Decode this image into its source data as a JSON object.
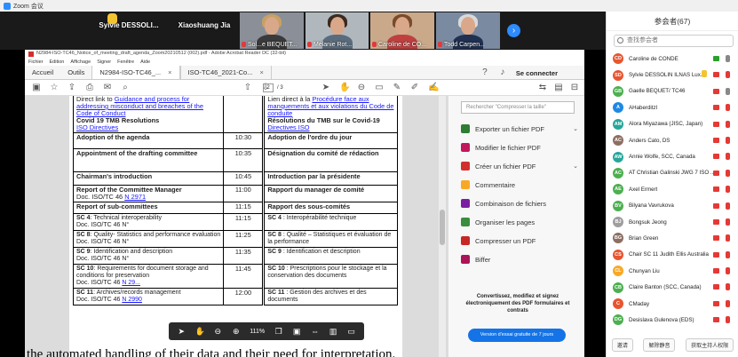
{
  "zoom": {
    "title": "Zoom 会议",
    "tiles": [
      {
        "name": "Sylvie  DESSOLI...",
        "video": false
      },
      {
        "name": "Xiaoshuang Jia",
        "video": false
      },
      {
        "name": "Sol...e BEQUET...",
        "video": true,
        "hair": "#c8a064",
        "shirt": "#3a3a3a",
        "bg": "#8a8f98"
      },
      {
        "name": "Mélanie Rot...",
        "video": true,
        "hair": "#3b2a1e",
        "shirt": "#5a6b7c",
        "bg": "#b0b8be"
      },
      {
        "name": "Caroline de CO...",
        "video": true,
        "hair": "#7a4a2a",
        "shirt": "#c04040",
        "bg": "#c9a98a"
      },
      {
        "name": "Todd Carpen...",
        "video": true,
        "hair": "#d9d9d9",
        "shirt": "#203050",
        "bg": "#7a8aa0"
      }
    ]
  },
  "acrobat": {
    "title": "N2984-ISO-TC46_Notice_of_meeting_draft_agenda_Zoom20210512 (002).pdf - Adobe Acrobat Reader DC (32-bit)",
    "menu": [
      "Fichier",
      "Edition",
      "Affichage",
      "Signer",
      "Fenêtre",
      "Aide"
    ],
    "tabs": {
      "home": "Accueil",
      "tools": "Outils",
      "doc1": "N2984-ISO-TC46_...",
      "doc2": "ISO-TC46_2021-Co..."
    },
    "connect": "Se connecter",
    "page_current": "2",
    "page_total": "/ 3",
    "zoom_level": "111%",
    "search_tools_placeholder": "Rechercher \"Compresser la taille\"",
    "tools": [
      {
        "label": "Exporter un fichier PDF",
        "color": "#2e7d32",
        "chev": true
      },
      {
        "label": "Modifier le fichier PDF",
        "color": "#c2185b",
        "chev": false
      },
      {
        "label": "Créer un fichier PDF",
        "color": "#d32f2f",
        "chev": true
      },
      {
        "label": "Commentaire",
        "color": "#f9a825",
        "chev": false
      },
      {
        "label": "Combinaison de fichiers",
        "color": "#7b1fa2",
        "chev": false
      },
      {
        "label": "Organiser les pages",
        "color": "#388e3c",
        "chev": false
      },
      {
        "label": "Compresser un PDF",
        "color": "#c62828",
        "chev": false
      },
      {
        "label": "Biffer",
        "color": "#ad1457",
        "chev": false
      }
    ],
    "promo_text": "Convertissez, modifiez et signez électroniquement des PDF formulaires et contrats",
    "promo_button": "Version d'essai gratuite de 7 jours"
  },
  "agenda": {
    "row0": {
      "en_pre": "Direct link to ",
      "en_link": "Guidance and process for addressing misconduct and breaches of the Code of Conduct",
      "en_bold": "Covid 19 TMB Resolutions",
      "en_link2": "ISO Directives",
      "fr_pre": "Lien direct à la ",
      "fr_link": "Procédure face aux manquements et aux violations du Code de conduite",
      "fr_bold": "Résolutions du TMB sur le Covid-19",
      "fr_link2": "Directives ISO"
    },
    "rows": [
      {
        "en": "Adoption of the agenda",
        "time": "10:30",
        "fr": "Adoption de l'ordre du jour"
      },
      {
        "en": "Appointment of the drafting committee",
        "time": "10:35",
        "fr": "Désignation du comité de rédaction"
      },
      {
        "en": "Chairman's introduction",
        "time": "10:45",
        "fr": "Introduction par la présidente"
      },
      {
        "en": "Report of the Committee Manager",
        "en_doc": "Doc. ISO/TC 46 ",
        "en_doc_link": "N 2971",
        "time": "11:00",
        "fr": "Rapport du manager de comité"
      },
      {
        "en": "Report of sub-committees",
        "time": "11:15",
        "fr": "Rapport des sous-comités"
      }
    ],
    "sc_rows": [
      {
        "en_b": "SC 4",
        "en": ": Technical interoperability",
        "en_doc": "Doc. ISO/TC 46 N°",
        "time": "11:15",
        "fr_b": "SC 4",
        "fr": " : Interopérabilité technique"
      },
      {
        "en_b": "SC 8",
        "en": ": Quality- Statistics and performance evaluation",
        "en_doc": "Doc. ISO/TC 46 N°",
        "time": "11:25",
        "fr_b": "SC 8",
        "fr": " : Qualité – Statistiques et évaluation de la performance"
      },
      {
        "en_b": "SC 9",
        "en": ": Identification and description",
        "en_doc": "Doc. ISO/TC 46 N°",
        "time": "11:35",
        "fr_b": "SC 9",
        "fr": " : Identification et description"
      },
      {
        "en_b": "SC 10",
        "en": ": Requirements for document storage and conditions for preservation",
        "en_doc": "Doc. ISO/TC 46 ",
        "en_doc_link": "N 29...",
        "time": "11:45",
        "fr_b": "SC 10",
        "fr": " : Prescriptions pour le stockage et la conservation des documents"
      },
      {
        "en_b": "SC 11",
        "en": ": Archives/records management",
        "en_doc": "Doc. ISO/TC 46 ",
        "en_doc_link": "N 2990",
        "time": "12:00",
        "fr_b": "SC 11",
        "fr": " : Gestion des archives et des documents"
      }
    ]
  },
  "caption": "the automated handling of their data and their need for interpretation.",
  "participants": {
    "header": "参会者(67)",
    "search_placeholder": "查找参会者",
    "list": [
      {
        "initials": "CD",
        "color": "#e8552f",
        "name": "Caroline de CONDE",
        "cam": "on",
        "mic": "on",
        "hand": false
      },
      {
        "initials": "SD",
        "color": "#e8552f",
        "name": "Sylvie DESSOLIN ILNAS Lux...",
        "cam": "off",
        "mic": "muted",
        "hand": true
      },
      {
        "initials": "GB",
        "color": "#4caf50",
        "name": "Gaelle BEQUET/ TC46",
        "cam": "off",
        "mic": "on",
        "hand": false
      },
      {
        "initials": "A",
        "color": "#1e88e5",
        "name": "AHaberditzl",
        "cam": "off",
        "mic": "muted",
        "hand": false
      },
      {
        "initials": "AM",
        "color": "#26a69a",
        "name": "Alora Miyazawa (JISC, Japan)",
        "cam": "off",
        "mic": "muted",
        "hand": false
      },
      {
        "initials": "AC",
        "color": "#8d6e63",
        "name": "Anders Cato, DS",
        "cam": "off",
        "mic": "muted",
        "hand": false
      },
      {
        "initials": "AW",
        "color": "#26a69a",
        "name": "Annie Wolfe, SCC, Canada",
        "cam": "off",
        "mic": "muted",
        "hand": false
      },
      {
        "initials": "AC",
        "color": "#4caf50",
        "name": "AT Christian Galinski JWG 7 ISO ...",
        "cam": "off",
        "mic": "muted",
        "hand": false
      },
      {
        "initials": "AE",
        "color": "#4caf50",
        "name": "Axel Ermert",
        "cam": "off",
        "mic": "muted",
        "hand": false
      },
      {
        "initials": "BV",
        "color": "#4caf50",
        "name": "Bilyana Vavrukova",
        "cam": "off",
        "mic": "muted",
        "hand": false
      },
      {
        "initials": "BJ",
        "color": "#9e9e9e",
        "name": "Bongsuk Jeong",
        "cam": "off",
        "mic": "muted",
        "hand": false
      },
      {
        "initials": "BG",
        "color": "#8d6e63",
        "name": "Brian Green",
        "cam": "off",
        "mic": "muted",
        "hand": false
      },
      {
        "initials": "CS",
        "color": "#e8552f",
        "name": "Chair SC 11 Judith Ellis Australia",
        "cam": "off",
        "mic": "muted",
        "hand": false
      },
      {
        "initials": "CL",
        "color": "#f9a825",
        "name": "Chunyan Liu",
        "cam": "off",
        "mic": "muted",
        "hand": false
      },
      {
        "initials": "CB",
        "color": "#4caf50",
        "name": "Claire Banton (SCC, Canada)",
        "cam": "off",
        "mic": "muted",
        "hand": false
      },
      {
        "initials": "C",
        "color": "#e8552f",
        "name": "CMaday",
        "cam": "off",
        "mic": "muted",
        "hand": false
      },
      {
        "initials": "DG",
        "color": "#4caf50",
        "name": "Desislava Gulenova (EDS)",
        "cam": "off",
        "mic": "muted",
        "hand": false
      }
    ],
    "footer": {
      "invite": "邀请",
      "mute_all": "解除静音",
      "more": "获取主持人权限"
    }
  }
}
